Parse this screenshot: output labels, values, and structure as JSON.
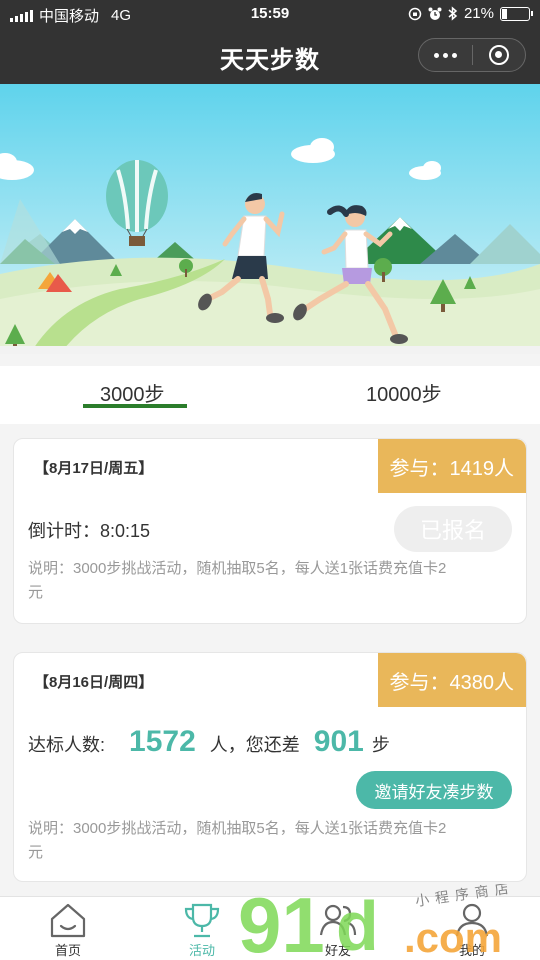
{
  "status_bar": {
    "carrier": "中国移动",
    "network": "4G",
    "time": "15:59",
    "battery": "21%",
    "battery_level": 0.21
  },
  "nav": {
    "title": "天天步数",
    "more_icon": "more-dots-icon",
    "close_icon": "target-icon"
  },
  "tabs": [
    {
      "label": "3000步",
      "active": true
    },
    {
      "label": "10000步",
      "active": false
    }
  ],
  "cards": [
    {
      "date": "【8月17日/周五】",
      "participants": "参与：1419人",
      "countdown": "倒计时：8:0:15",
      "button": "已报名",
      "desc": "说明：3000步挑战活动，随机抽取5名，每人送1张话费充值卡2元"
    },
    {
      "date": "【8月16日/周四】",
      "participants": "参与：4380人",
      "stat_prefix": "达标人数:",
      "qualified": "1572",
      "stat_mid": "人，您还差",
      "remaining": "901",
      "stat_suffix": "步",
      "button": "邀请好友凑步数",
      "desc": "说明：3000步挑战活动，随机抽取5名，每人送1张话费充值卡2元"
    }
  ],
  "tabbar": [
    {
      "label": "首页",
      "icon": "home-icon",
      "active": false
    },
    {
      "label": "活动",
      "icon": "trophy-icon",
      "active": true
    },
    {
      "label": "好友",
      "icon": "friends-icon",
      "active": false
    },
    {
      "label": "我的",
      "icon": "profile-icon",
      "active": false
    }
  ],
  "watermark": {
    "brand": "91",
    "brand_mid": "d",
    "domain": ".com",
    "tagline": "小程序商店"
  },
  "colors": {
    "nav_bg": "#333333",
    "accent": "#4cb8a8",
    "badge": "#e9b75a",
    "tab_underline": "#2b7d2b"
  }
}
